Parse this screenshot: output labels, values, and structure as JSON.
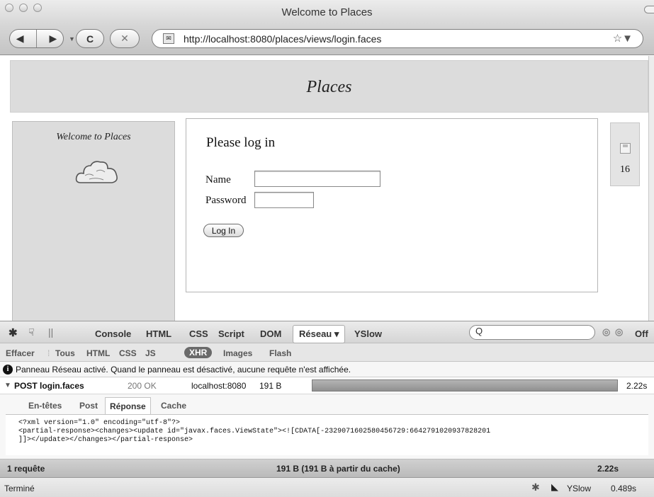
{
  "window": {
    "title": "Welcome to Places"
  },
  "toolbar": {
    "back": "◀",
    "forward": "▶",
    "reload": "C",
    "stop": "✕",
    "url": "http://localhost:8080/places/views/login.faces",
    "bookmark": "☆▼"
  },
  "page": {
    "header_title": "Places",
    "sidebar_welcome": "Welcome to Places",
    "login_heading": "Please log in",
    "name_label": "Name",
    "password_label": "Password",
    "name_value": "",
    "password_value": "",
    "login_button": "Log In",
    "widget_count": "16"
  },
  "firebug": {
    "tabs": [
      "Console",
      "HTML",
      "CSS",
      "Script",
      "DOM",
      "Réseau ▾",
      "YSlow"
    ],
    "search_icon": "Q",
    "off_label": "Off",
    "filters": [
      "Effacer",
      "Tous",
      "HTML",
      "CSS",
      "JS",
      "XHR",
      "Images",
      "Flash"
    ],
    "info_message": "Panneau Réseau activé. Quand le panneau est désactivé, aucune requête n'est affichée.",
    "request": {
      "method_file": "POST login.faces",
      "status": "200 OK",
      "domain": "localhost:8080",
      "size": "191 B",
      "time": "2.22s"
    },
    "detail_tabs": [
      "En-têtes",
      "Post",
      "Réponse",
      "Cache"
    ],
    "response_lines": [
      "<?xml version=\"1.0\" encoding=\"utf-8\"?>",
      "<partial-response><changes><update id=\"javax.faces.ViewState\"><![CDATA[-2329071602580456729:6642791020937828201",
      "]]></update></changes></partial-response>"
    ],
    "summary": {
      "requests": "1 requête",
      "size": "191 B  (191 B à partir du cache)",
      "time": "2.22s"
    }
  },
  "statusbar": {
    "text": "Terminé",
    "yslow": "YSlow",
    "time": "0.489s"
  }
}
